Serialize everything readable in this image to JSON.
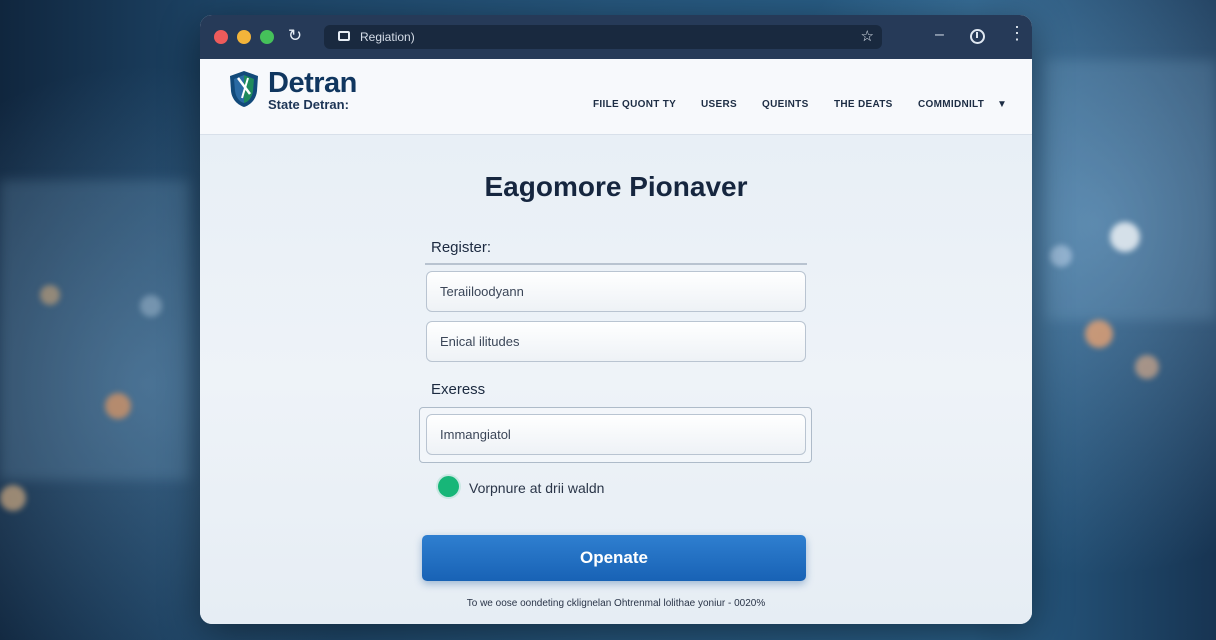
{
  "browser": {
    "tab_title": "Regiation)",
    "icons": [
      "reload-icon",
      "page-icon",
      "star-icon",
      "minimize-icon",
      "history-icon",
      "more-icon"
    ]
  },
  "site": {
    "logo_title": "Detran",
    "logo_subtitle": "State Detran:",
    "nav": [
      {
        "label": "FIILE QUONT TY"
      },
      {
        "label": "USERS"
      },
      {
        "label": "QUEINTS"
      },
      {
        "label": "THE DEATS"
      },
      {
        "label": "COMMIDNILT"
      }
    ]
  },
  "form": {
    "title": "Eagomore Pionaver",
    "register_label": "Register:",
    "field1_value": "Teraiiloodyann",
    "field2_value": "Enical ilitudes",
    "express_label": "Exeress",
    "field3_value": "Immangiatol",
    "option_label": "Vorpnure at drii waldn",
    "submit_label": "Openate",
    "footnote": "To we oose oondeting cklignelan Ohtrenmal lolithae yoniur - 0020%"
  },
  "colors": {
    "accent": "#1862b5",
    "radio_green": "#17b678",
    "titlebar": "#263a58",
    "logo_navy": "#10365f"
  }
}
